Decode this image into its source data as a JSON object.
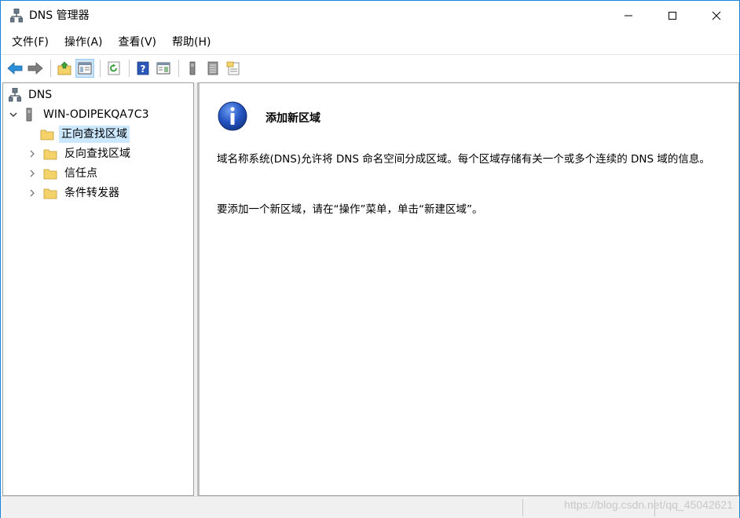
{
  "window": {
    "title": "DNS 管理器"
  },
  "menu": {
    "items": [
      "文件(F)",
      "操作(A)",
      "查看(V)",
      "帮助(H)"
    ]
  },
  "toolbar": {
    "buttons": [
      "back-icon",
      "forward-icon",
      "up-folder-icon",
      "show-hide-tree-icon",
      "refresh-icon",
      "help-icon",
      "action-pane-icon",
      "server-icon",
      "list-icon",
      "properties-icon"
    ]
  },
  "tree": {
    "root": "DNS",
    "server": "WIN-ODIPEKQA7C3",
    "items": [
      {
        "label": "正向查找区域",
        "selected": true,
        "expandable": false
      },
      {
        "label": "反向查找区域",
        "selected": false,
        "expandable": true
      },
      {
        "label": "信任点",
        "selected": false,
        "expandable": true
      },
      {
        "label": "条件转发器",
        "selected": false,
        "expandable": true
      }
    ]
  },
  "content": {
    "title": "添加新区域",
    "paragraph1": "域名称系统(DNS)允许将 DNS 命名空间分成区域。每个区域存储有关一个或多个连续的 DNS 域的信息。",
    "paragraph2": "要添加一个新区域，请在“操作”菜单，单击“新建区域”。"
  },
  "statusbar": {
    "watermark": "https://blog.csdn.net/qq_45042621"
  },
  "colors": {
    "accent_border": "#1883d7",
    "selection": "#cce8ff",
    "folder": "#f5d36b",
    "info_blue": "#1e4fb4"
  }
}
